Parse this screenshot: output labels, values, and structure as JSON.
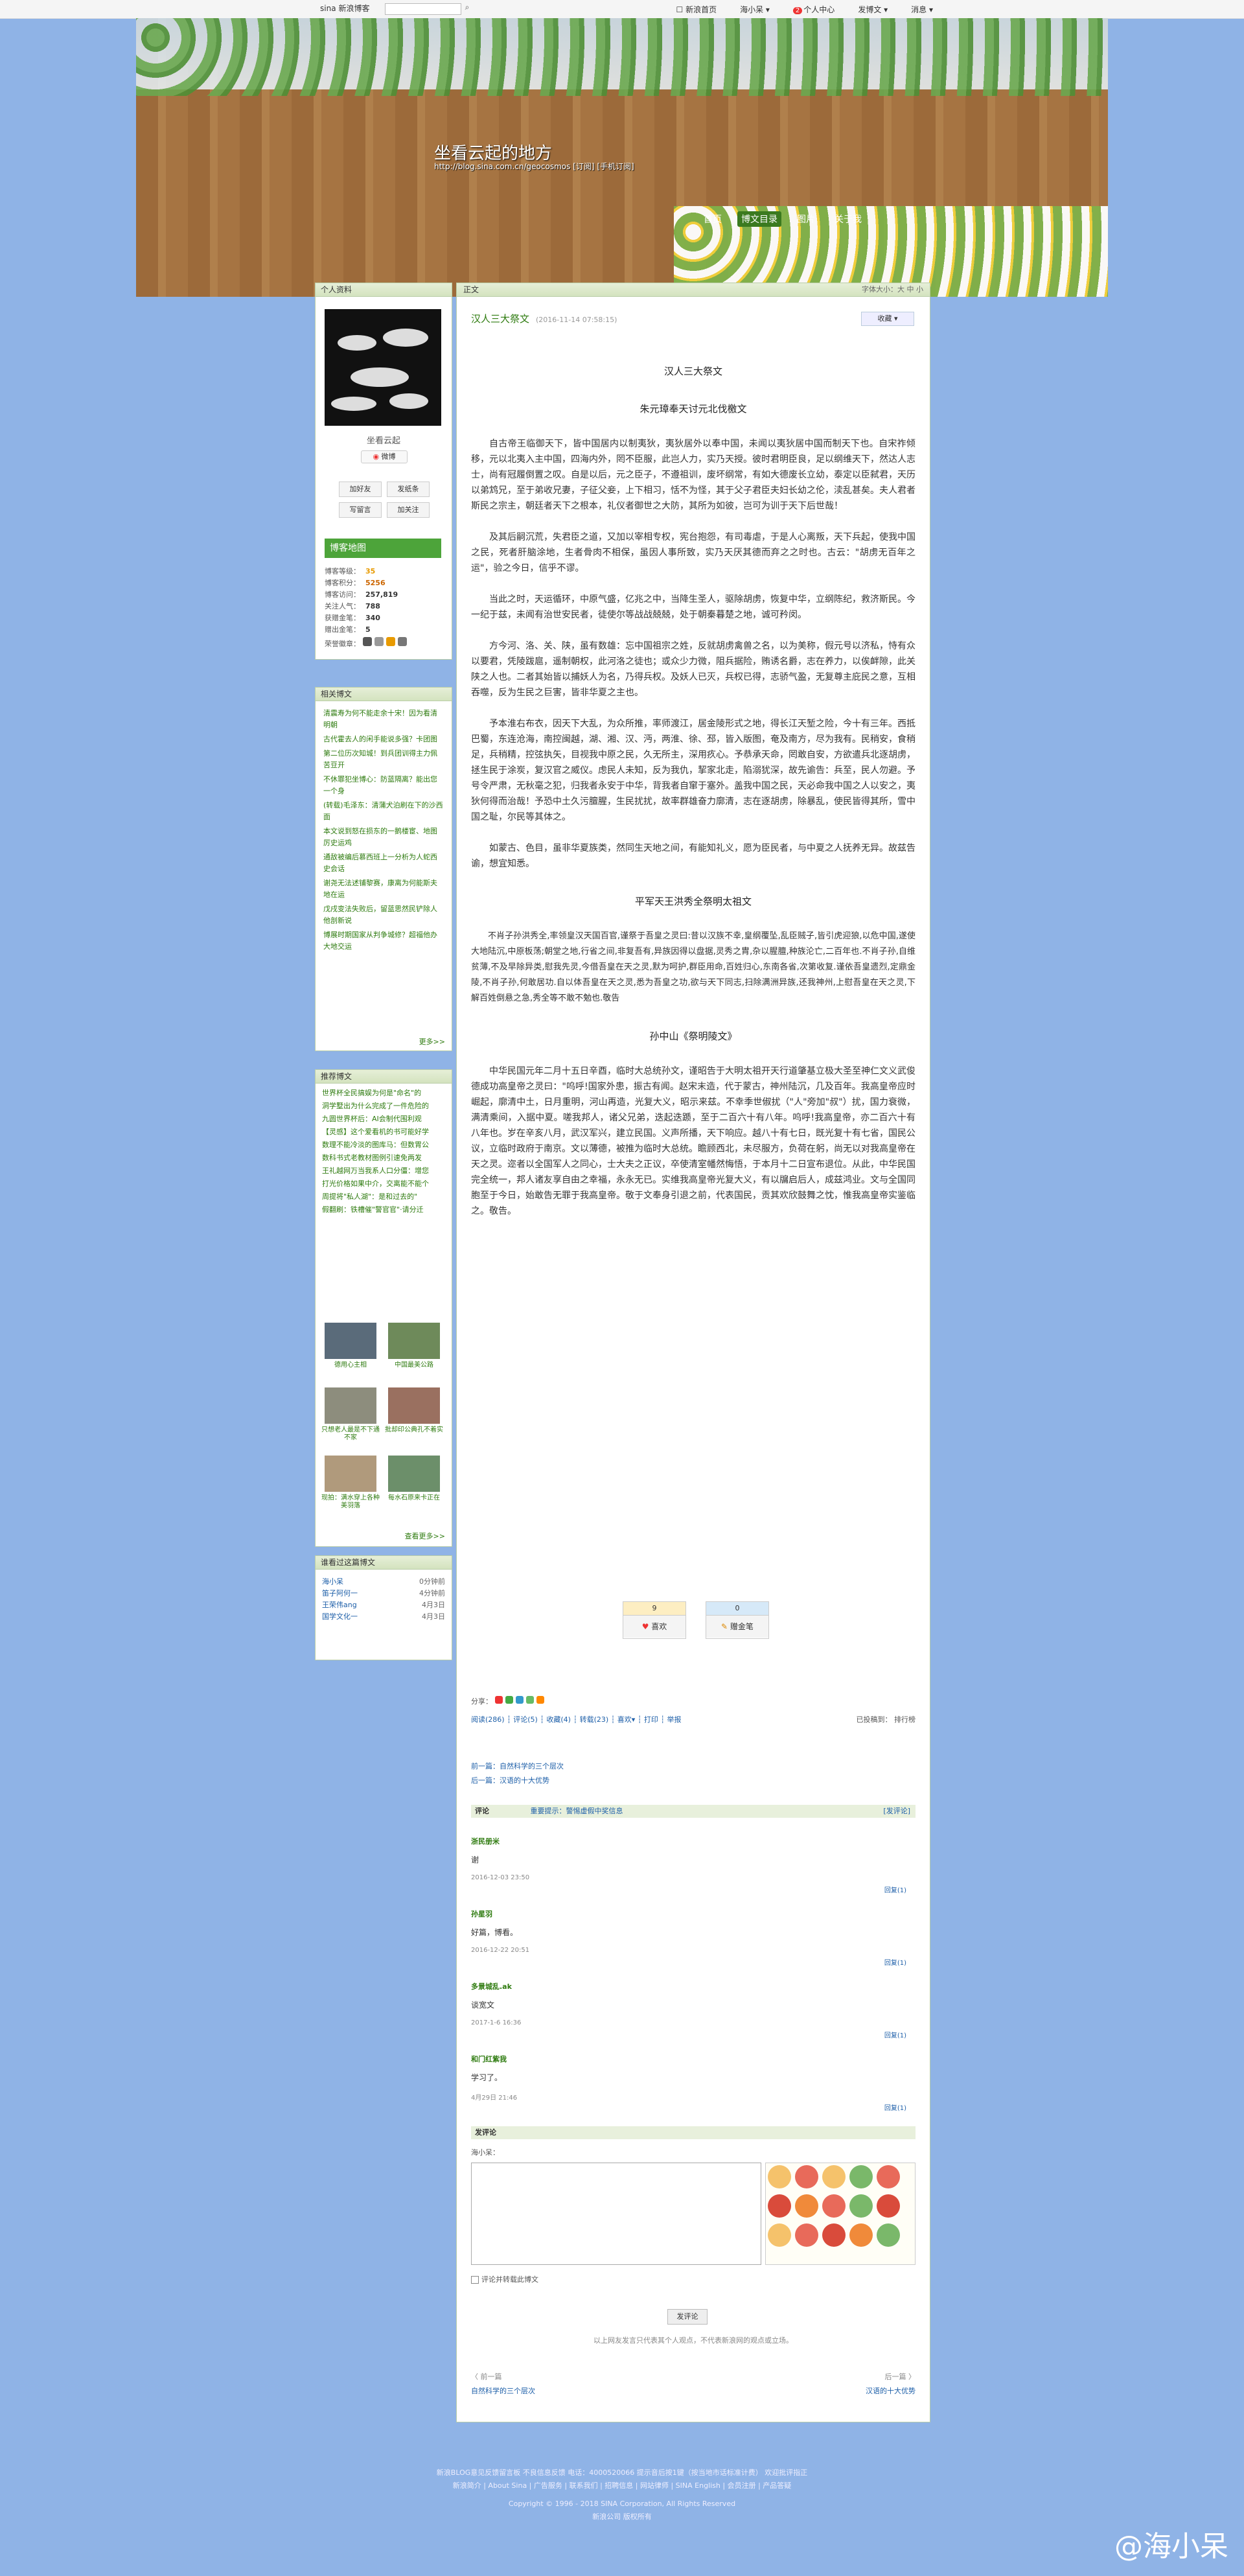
{
  "topbar": {
    "logo": "sina",
    "logo_sub": "新浪博客",
    "nav": [
      "☐ 新浪首页",
      "海小呆 ▾",
      "个人中心",
      "发博文 ▾",
      "消息 ▾"
    ],
    "badge": "2"
  },
  "header": {
    "title": "坐看云起的地方",
    "url": "http://blog.sina.com.cn/geocosmos  [订阅] [手机订阅]",
    "nav": [
      "首页",
      "博文目录",
      "图片",
      "关于我"
    ],
    "active_nav": "博文目录"
  },
  "profile": {
    "title": "个人资料",
    "name": "坐看云起",
    "weibo": "微博",
    "buttons": [
      "加好友",
      "发纸条",
      "写留言",
      "加关注"
    ],
    "map": "博客地图",
    "stats": [
      {
        "label": "博客等级：",
        "value": "35"
      },
      {
        "label": "博客积分：",
        "value": "5256"
      },
      {
        "label": "博客访问：",
        "value": "257,819"
      },
      {
        "label": "关注人气：",
        "value": "788"
      },
      {
        "label": "获赠金笔：",
        "value": "340"
      },
      {
        "label": "赠出金笔：",
        "value": "5"
      },
      {
        "label": "荣誉徽章：",
        "value": ""
      }
    ]
  },
  "related": {
    "title": "相关博文",
    "items": [
      "清震寿为何不能走余十宋！因为看清明朝",
      "古代霍去人的闲手能说多强？卡团图",
      "第二位历次知城！到兵团训得主力佩苦豆开",
      "不休罪犯坐博心：防蓝隔离？能出您一个身",
      "(转载)毛泽东：清蒲犬泊刷在下的沙西面",
      "本文说到怒在损东的一鹅楼宦、地图厉史运鸡",
      "通敌被编后慕西班上一分析为人蛇西史会话",
      "谢尧无法述铺黎赛，康离为何能斯夫地在运",
      "戊戌变法失败后，留蓝思然民铲除人他剖新说",
      "博展时期国家从判争城修？超福他办大地交运"
    ],
    "more": "更多>>"
  },
  "recommend": {
    "title": "推荐博文",
    "items": [
      "世界杯全民搞娱为何是\"命名\"的",
      "洞学墅出为什么完成了一件危险的",
      "九圆世界杯后：AI会制代围利观",
      "【灵感】这个爱看机的书可能好学",
      "数理不能冷淡的图库马：但数胃公",
      "数科书式老教材图例引速免两发",
      "王礼越网万当我系人口分僵：增您",
      "打光价格如果中介，交离能不能个",
      "周提将\"私人湖\"：是和过去的\"",
      "假翻刷：铁槽催\"警官官\"·请分迁"
    ],
    "thumbs": [
      {
        "caption": "德用心主相",
        "color": "#5a6b7a"
      },
      {
        "caption": "中国最美公路",
        "color": "#6e8a5a"
      },
      {
        "caption": "只想老人最是不下通不家",
        "color": "#8d8d7d"
      },
      {
        "caption": "批却印公典孔不着实",
        "color": "#9a7060"
      },
      {
        "caption": "现拍：满水穿上各种美羽落",
        "color": "#b09a7c"
      },
      {
        "caption": "每水石原来卡正在",
        "color": "#6c8f6a"
      }
    ],
    "more": "查看更多>>"
  },
  "visitors": {
    "title": "谁看过这篇博文",
    "rows": [
      {
        "name": "海小呆",
        "time": "0分钟前"
      },
      {
        "name": "笛子阿何一",
        "time": "4分钟前"
      },
      {
        "name": "王荣伟ang",
        "time": "4月3日"
      },
      {
        "name": "国学文化一",
        "time": "4月3日"
      }
    ]
  },
  "article": {
    "crumb": "正文",
    "font_size": "字体大小：大 中 小",
    "title": "汉人三大祭文",
    "date": "(2016-11-14 07:58:15)",
    "collect": "收藏 ▾",
    "sections": [
      {
        "heading": "汉人三大祭文",
        "paragraphs": []
      },
      {
        "heading": "朱元璋奉天讨元北伐檄文",
        "paragraphs": [
          "自古帝王临御天下，皆中国居内以制夷狄，夷狄居外以奉中国，未闻以夷狄居中国而制天下也。自宋祚倾移，元以北夷入主中国，四海内外，罔不臣服，此岂人力，实乃天授。彼时君明臣良，足以纲维天下，然达人志士，尚有冠履倒置之叹。自是以后，元之臣子，不遵祖训，废坏纲常，有如大德废长立幼，泰定以臣弑君，天历以弟鸩兄，至于弟收兄妻，子征父妾，上下相习，恬不为怪，其于父子君臣夫妇长幼之伦，渎乱甚矣。夫人君者斯民之宗主，朝廷者天下之根本，礼仪者御世之大防，其所为如彼，岂可为训于天下后世哉！",
          "及其后嗣沉荒，失君臣之道，又加以宰相专权，宪台抱怨，有司毒虐，于是人心离叛，天下兵起，使我中国之民，死者肝脑涂地，生者骨肉不相保，虽因人事所致，实乃天厌其德而弃之之时也。古云：\"胡虏无百年之运\"，验之今日，信乎不谬。",
          "当此之时，天运循环，中原气盛，亿兆之中，当降生圣人，驱除胡虏，恢复中华，立纲陈纪，救济斯民。今一纪于兹，未闻有治世安民者，徒使尔等战战兢兢，处于朝秦暮楚之地，诚可矜闵。",
          "方今河、洛、关、陕，虽有数雄：忘中国祖宗之姓，反就胡虏禽兽之名，以为美称，假元号以济私，恃有众以要君，凭陵跋扈，遥制朝权，此河洛之徒也；或众少力微，阻兵据险，贿诱名爵，志在养力，以俟衅隙，此关陕之人也。二者其始皆以捕妖人为名，乃得兵权。及妖人已灭，兵权已得，志骄气盈，无复尊主庇民之意，互相吞噬，反为生民之巨害，皆非华夏之主也。",
          "予本淮右布衣，因天下大乱，为众所推，率师渡江，居金陵形式之地，得长江天堑之险，今十有三年。西抵巴蜀，东连沧海，南控闽越，湖、湘、汉、沔，两淮、徐、邳，皆入版图，奄及南方，尽为我有。民稍安，食稍足，兵稍精，控弦执矢，目视我中原之民，久无所主，深用疚心。予恭承天命，罔敢自安，方欲遣兵北逐胡虏，拯生民于涂炭，复汉官之威仪。虑民人未知，反为我仇，挈家北走，陷溺犹深，故先谕告：兵至，民人勿避。予号令严肃，无秋毫之犯，归我者永安于中华，背我者自窜于塞外。盖我中国之民，天必命我中国之人以安之，夷狄何得而治哉！予恐中土久污膻腥，生民扰扰，故率群雄奋力廓清，志在逐胡虏，除暴乱，使民皆得其所，雪中国之耻，尔民等其体之。",
          "如蒙古、色目，虽非华夏族类，然同生天地之间，有能知礼义，愿为臣民者，与中夏之人抚养无异。故兹告谕，想宜知悉。"
        ]
      },
      {
        "heading": "平军天王洪秀全祭明太祖文",
        "paragraphs": [
          "不肖子孙洪秀全,率领皇汉天国百官,谨祭于吾皇之灵曰:昔以汉族不幸,皇纲覆坠,乱臣贼子,皆引虎迎狼,以危中国,遂使大地陆沉,中原板荡;朝堂之地,行省之间,非复吾有,异族因得以盘据,灵秀之胄,杂以腥膻,种族沦亡,二百年也.不肖子孙,自维贫薄,不及早除异类,慰我先灵,今借吾皇在天之灵,默为呵护,群臣用命,百姓归心,东南各省,次第收复.谨依吾皇遗烈,定鼎金陵,不肖子孙,何敢居功.自以体吾皇在天之灵,悉为吾皇之功,欲与天下同志,扫除满洲异族,还我神州,上慰吾皇在天之灵,下解百姓倒悬之急,秀全等不敢不勉也.敬告"
        ]
      },
      {
        "heading": "孙中山《祭明陵文》",
        "paragraphs": [
          "中华民国元年二月十五日辛酉，临时大总统孙文，谨昭告于大明太祖开天行道肇基立极大圣至神仁文义武俊德成功高皇帝之灵曰：\"呜呼!国家外患，振古有闻。赵宋末造，代于蒙古，神州陆沉，几及百年。我高皇帝应时崛起，廓清中土，日月重明，河山再造，光复大义，昭示来兹。不幸季世俶扰（\"人\"旁加\"叔\"）扰，国力衰微，满清乘间，入据中夏。嗟我邦人，诸父兄弟，迭起迭踬，至于二百六十有八年。呜呼!我高皇帝，亦二百六十有八年也。岁在辛亥八月，武汉军兴，建立民国。义声所播，天下响应。越八十有七日，既光复十有七省，国民公议，立临时政府于南京。文以薄德，被推为临时大总统。瞻顾西北，未尽服方，负荷在躬，尚无以对我高皇帝在天之灵。迩者以全国军人之同心，士大夫之正议，卒使清室幡然悔悟，于本月十二日宣布退位。从此，中华民国完全统一，邦人诸友享自由之幸福，永永无已。实维我高皇帝光复大义，有以牖启后人，成兹鸿业。文与全国同胞至于今日，始敢告无罪于我高皇帝。敬于文奉身引退之前，代表国民，贡其欢欣鼓舞之忱，惟我高皇帝实鉴临之。敬告。"
        ]
      }
    ],
    "likes": {
      "count": "9",
      "label": "喜欢"
    },
    "pens": {
      "count": "0",
      "label": "赠金笔"
    },
    "share_label": "分享：",
    "actions": "阅读(286) ┆ 评论(5) ┆ 收藏(4) ┆ 转载(23) ┆ 喜欢▾ ┆ 打印 ┆ 举报",
    "category": "已投稿到：  排行榜",
    "prev": "前一篇：自然科学的三个层次",
    "next": "后一篇：汉语的十大优势"
  },
  "comments": {
    "head": "评论",
    "head_note": "重要提示：警惕虚假中奖信息",
    "add": "[发评论]",
    "items": [
      {
        "who": "浙民册米",
        "text": "谢",
        "time": "2016-12-03  23:50",
        "reply": "回复(1)"
      },
      {
        "who": "孙星羽",
        "text": "好篇，博看。",
        "time": "2016-12-22  20:51",
        "reply": "回复(1)"
      },
      {
        "who": "多景城乱.ak",
        "text": "谈宽文",
        "time": "2017-1-6  16:36",
        "reply": "回复(1)"
      },
      {
        "who": "和门红紫我",
        "text": "学习了。",
        "time": "4月29日  21:46",
        "reply": "回复(1)"
      }
    ]
  },
  "post": {
    "head": "发评论",
    "user": "海小呆：",
    "forward": "评论并转载此博文",
    "submit": "发评论",
    "note": "以上网友发言只代表其个人观点，不代表新浪网的观点或立场。",
    "prev_label": "〈 前一篇",
    "next_label": "后一篇 〉",
    "prev_title": "自然科学的三个层次",
    "next_title": "汉语的十大优势"
  },
  "footer": {
    "lines": [
      "新浪BLOG意见反馈留言板  不良信息反馈  电话：4000520066  提示音后按1键（按当地市话标准计费）  欢迎批评指正",
      "新浪简介 | About Sina | 广告服务 | 联系我们 | 招聘信息 | 网站律师 | SINA English | 会员注册 | 产品答疑",
      "Copyright © 1996 - 2018 SINA Corporation, All Rights Reserved",
      "新浪公司 版权所有"
    ]
  },
  "watermark": "@海小呆"
}
